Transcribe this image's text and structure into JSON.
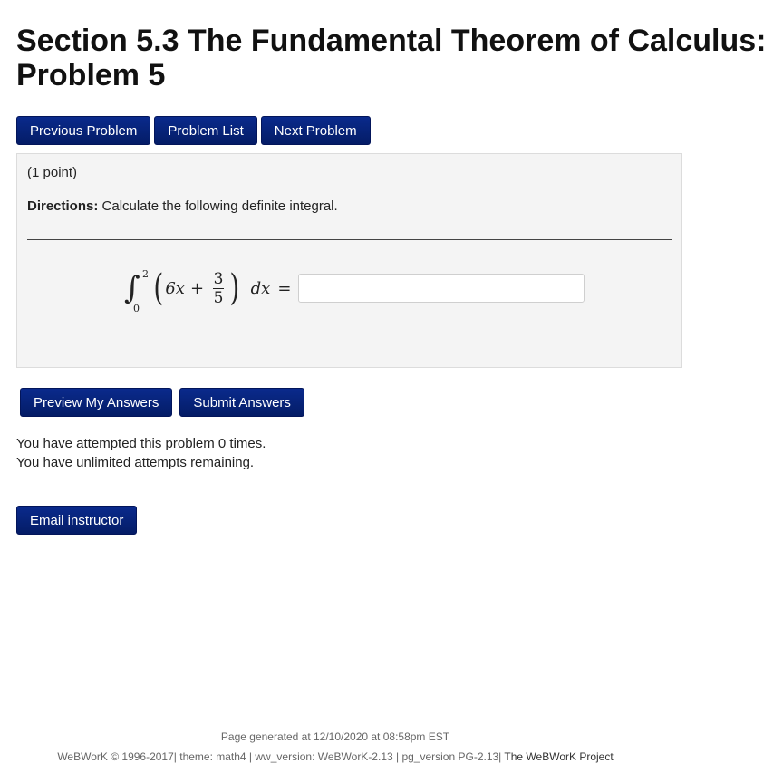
{
  "page": {
    "title": "Section 5.3 The Fundamental Theorem of Calculus: Problem 5"
  },
  "nav": {
    "previous": "Previous Problem",
    "list": "Problem List",
    "next": "Next Problem"
  },
  "problem": {
    "points": "(1 point)",
    "directions_label": "Directions:",
    "directions_text": " Calculate the following definite integral.",
    "integral": {
      "lower_limit": "0",
      "upper_limit": "2",
      "term1": "6x",
      "plus": "+",
      "numerator": "3",
      "denominator": "5",
      "differential": "dx",
      "equals": "="
    },
    "answer_value": "",
    "answer_placeholder": ""
  },
  "actions": {
    "preview": "Preview My Answers",
    "submit": "Submit Answers"
  },
  "status": {
    "attempts": "You have attempted this problem 0 times.",
    "remaining": "You have unlimited attempts remaining."
  },
  "email": {
    "label": "Email instructor"
  },
  "footer": {
    "generated": "Page generated at 12/10/2020 at 08:58pm EST",
    "info": "WeBWorK © 1996-2017| theme: math4 | ww_version: WeBWorK-2.13 | pg_version PG-2.13| ",
    "project_link": "The WeBWorK Project"
  }
}
